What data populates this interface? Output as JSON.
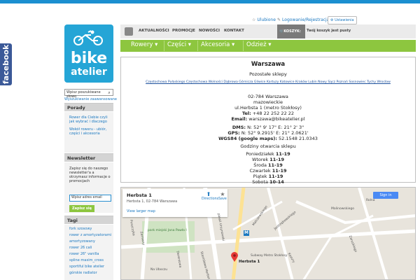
{
  "facebook": {
    "label": "facebook"
  },
  "logo": {
    "word1": "bike",
    "word2": "atelier"
  },
  "search": {
    "placeholder": "Wpisz poszukiwane słowo",
    "advanced_link": "Wyszukiwanie zaawansowane"
  },
  "sidebar": {
    "porady": {
      "title": "Porady",
      "links": [
        "Rower dla Ciebie czyli jak wybrać i dlaczego",
        "Wokół roweru - ubiór, części i akcesoria"
      ]
    },
    "newsletter": {
      "title": "Newsletter",
      "text": "Zapisz się do naszego newsletter'a a otrzymasz informacje o promocjach",
      "input_placeholder": "Wpisz adres email",
      "button_label": "Zapisz się"
    },
    "tags": {
      "title": "Tagi",
      "items": [
        "fork szosowy",
        "rower z amortyzatorami",
        "amortyzowany",
        "rower 26 cali",
        "rower 26\" vanilla",
        "spline maxim_cross",
        "sportiful bike atelier",
        "górskie radiator"
      ]
    }
  },
  "header": {
    "favorites": "Ulubione",
    "login": "Logowanie/Rejestracja",
    "settings": "Ustawienia",
    "nav": [
      "AKTUALNOŚCI",
      "PROMOCJE",
      "NOWOŚCI",
      "KONTAKT"
    ],
    "cart_label": "KOSZYK:",
    "cart_status": "Twój koszyk jest pusty"
  },
  "categories": [
    "Rowery",
    "Części",
    "Akcesoria",
    "Odzież"
  ],
  "store": {
    "city": "Warszawa",
    "other_title": "Pozostałe sklepy",
    "other_links": "Częstochowa Pułaskiego  Częstochowa Wolności  Dąbrowa Górnicza  Gliwice  Kartuzy  Katowice  Kraków  Lubin  Nowy Sącz  Poznań  Sosnowiec  Tychy  Wrocław",
    "address1": "02-784 Warszawa",
    "address2": "mazowieckie",
    "address3": "ul.Herbsta 1 (metro Stokłosy)",
    "tel_label": "Tel:",
    "tel": "+48 22 252 22 22",
    "email_label": "Email:",
    "email": "warszawa@bikeatelier.pl",
    "dms_label": "DMS:",
    "dms": "N: 52° 9' 17\" E: 21° 2' 3\"",
    "gps_label": "GPS:",
    "gps": "N: 52° 9.2915' E: 21° 2.0621'",
    "wgs_label": "WGS84 (google maps):",
    "wgs": "52.1548 21.0343",
    "hours_title": "Godziny otwarcia sklepu",
    "hours": [
      {
        "day": "Poniedziałek",
        "time": "11-19"
      },
      {
        "day": "Wtorek",
        "time": "11-19"
      },
      {
        "day": "Środa",
        "time": "11-19"
      },
      {
        "day": "Czwartek",
        "time": "11-19"
      },
      {
        "day": "Piątek",
        "time": "11-19"
      },
      {
        "day": "Sobota",
        "time": "10-14"
      }
    ]
  },
  "map": {
    "place": "Herbsta 1",
    "address": "Herbsta 1, 02-784 Warszawa",
    "larger": "View larger map",
    "directions": "Directions",
    "save": "Save",
    "signin": "Sign in",
    "pin_label": "Herbsta 1",
    "metro": "Subway Metro Stokłosy",
    "park": "park miejski Jana Pawła I",
    "streets": [
      "Puszczyka",
      "Na Uboczu",
      "Dereniowa",
      "Stanisława Herbsta",
      "Zamiany",
      "pasaż Ursynowski",
      "Malczewskiego",
      "Jastrzębowskiego",
      "Kazury",
      "Zaruskiego",
      "Rolna",
      "Malinowskiego"
    ]
  },
  "colors": {
    "accent_blue": "#25a5d6",
    "green": "#8dc63f",
    "link": "#1b78c0"
  }
}
